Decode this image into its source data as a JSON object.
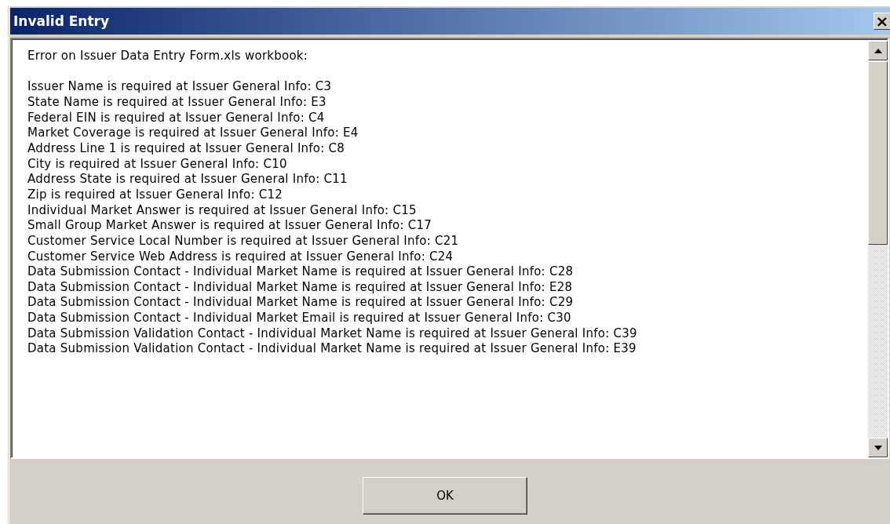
{
  "window": {
    "title": "Invalid Entry",
    "close": "×"
  },
  "message": {
    "heading": "Error on Issuer Data Entry Form.xls workbook:",
    "lines": [
      "Issuer Name is required at Issuer General Info: C3",
      "State Name is required at Issuer General Info: E3",
      "Federal EIN is required at Issuer General Info: C4",
      "Market Coverage is required at Issuer General Info: E4",
      "Address Line 1 is required at Issuer General Info: C8",
      "City is required at Issuer General Info: C10",
      "Address State is required at Issuer General Info: C11",
      "Zip is required at Issuer General Info: C12",
      "Individual Market Answer is required at Issuer General Info: C15",
      "Small Group Market Answer is required at Issuer General Info: C17",
      "Customer Service Local Number is required at Issuer General Info: C21",
      "Customer Service Web Address is required at Issuer General Info: C24",
      "Data Submission Contact - Individual Market Name is required at Issuer General Info: C28",
      "Data Submission Contact - Individual Market Name is required at Issuer General Info: E28",
      "Data Submission Contact - Individual Market Name is required at Issuer General Info: C29",
      "Data Submission Contact - Individual Market Email is required at Issuer General Info: C30",
      "Data Submission Validation Contact - Individual Market Name is required at Issuer General Info: C39",
      "Data Submission Validation Contact - Individual Market Name is required at Issuer General Info: E39"
    ]
  },
  "buttons": [
    "OK"
  ]
}
